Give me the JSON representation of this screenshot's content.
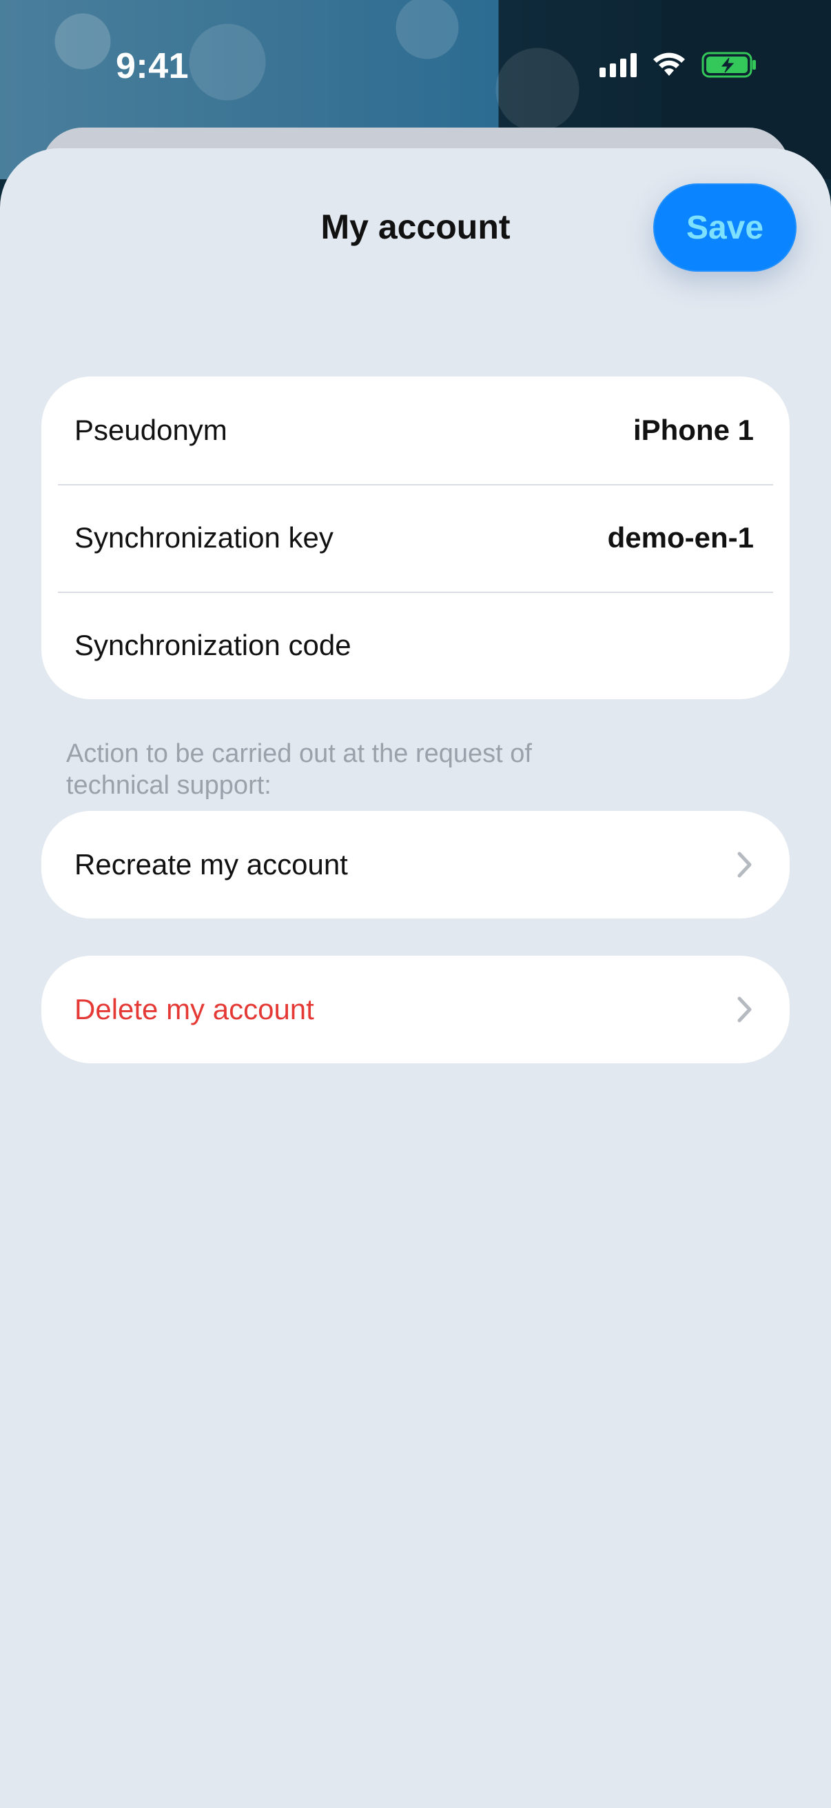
{
  "status_bar": {
    "time": "9:41",
    "icons": [
      "cellular-signal-icon",
      "wifi-icon",
      "battery-charging-icon"
    ],
    "battery_color": "#34c759"
  },
  "sheet": {
    "title": "My account",
    "save_label": "Save"
  },
  "account": {
    "rows": [
      {
        "label": "Pseudonym",
        "value": "iPhone 1"
      },
      {
        "label": "Synchronization key",
        "value": "demo-en-1"
      },
      {
        "label": "Synchronization code",
        "value": ""
      }
    ]
  },
  "support": {
    "note": "Action to be carried out at the request of technical support:",
    "recreate_label": "Recreate my account"
  },
  "danger": {
    "delete_label": "Delete my account",
    "delete_color": "#e53935"
  },
  "colors": {
    "accent": "#0a84ff",
    "sheet_background": "#e2e8f0",
    "card_background": "#ffffff"
  }
}
